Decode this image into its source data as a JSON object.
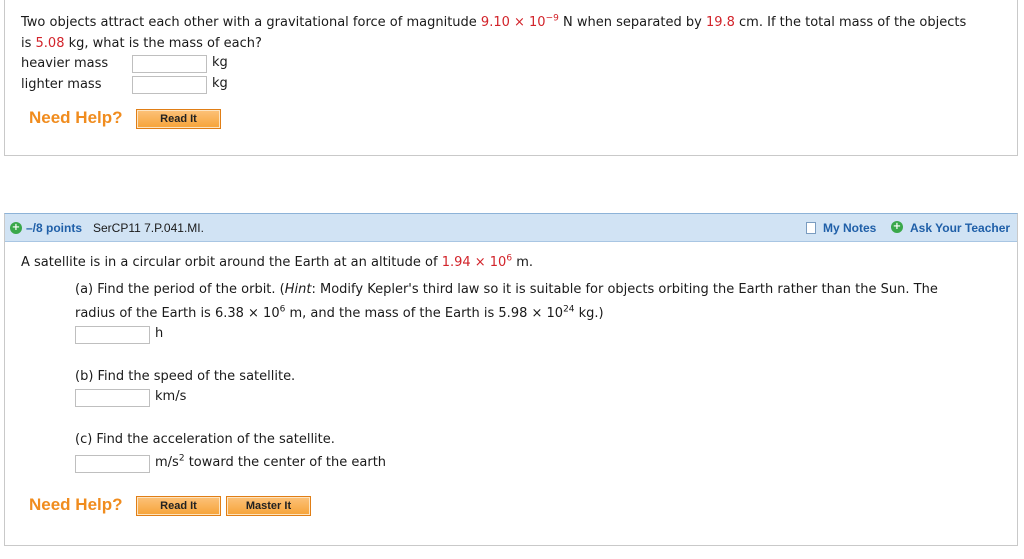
{
  "q1": {
    "text_a": "Two objects attract each other with a gravitational force of magnitude ",
    "force": "9.10 × 10",
    "force_exp": "−9",
    "text_b": " N when separated by ",
    "distance": "19.8",
    "text_c": " cm. If the total mass of the objects",
    "text_d": "is ",
    "mass": "5.08",
    "text_e": " kg, what is the mass of each?",
    "heavier_label": "heavier mass",
    "lighter_label": "lighter mass",
    "unit_kg": "kg",
    "need_help": "Need Help?",
    "read_it": "Read It"
  },
  "q2": {
    "points": "–/8 points",
    "code": "SerCP11 7.P.041.MI.",
    "my_notes": "My Notes",
    "ask_teacher": "Ask Your Teacher",
    "intro_a": "A satellite is in a circular orbit around the Earth at an altitude of ",
    "altitude": "1.94 × 10",
    "altitude_exp": "6",
    "intro_b": " m.",
    "a_line1_a": "(a) Find the period of the orbit. (",
    "a_hint": "Hint",
    "a_line1_b": ": Modify Kepler's third law so it is suitable for objects orbiting the Earth rather than the Sun. The",
    "a_line2_a": "radius of the Earth is 6.38 × 10",
    "a_line2_exp1": "6",
    "a_line2_b": " m, and the mass of the Earth is 5.98 × 10",
    "a_line2_exp2": "24",
    "a_line2_c": " kg.)",
    "a_unit": "h",
    "b_text": "(b) Find the speed of the satellite.",
    "b_unit": "km/s",
    "c_text": "(c) Find the acceleration of the satellite.",
    "c_unit_a": "m/s",
    "c_unit_exp": "2",
    "c_unit_b": " toward the center of the earth",
    "need_help": "Need Help?",
    "read_it": "Read It",
    "master_it": "Master It"
  }
}
